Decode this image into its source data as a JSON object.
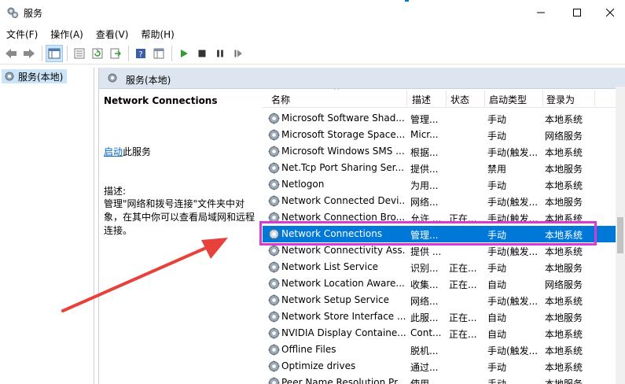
{
  "window": {
    "title": "服务"
  },
  "menu": [
    "文件(F)",
    "操作(A)",
    "查看(V)",
    "帮助(H)"
  ],
  "toolbar": {
    "icons": [
      "back-icon",
      "forward-icon",
      "console-tree-icon",
      "properties-icon",
      "refresh-icon",
      "export-icon",
      "help-icon",
      "view-icon",
      "start-service-icon",
      "stop-service-icon",
      "pause-service-icon",
      "resume-service-icon"
    ]
  },
  "tree": {
    "root_label": "服务(本地)"
  },
  "content": {
    "header_title": "服务(本地)",
    "selected_service_title": "Network Connections",
    "action_link": "启动",
    "action_suffix": "此服务",
    "desc_label": "描述:",
    "desc_text": "管理\"网络和拨号连接\"文件夹中对象，在其中你可以查看局域网和远程连接。"
  },
  "columns": {
    "name": "名称",
    "desc": "描述",
    "status": "状态",
    "start": "启动类型",
    "logon": "登录为"
  },
  "services": [
    {
      "name": "Microsoft Software Shad...",
      "desc": "管理...",
      "status": "",
      "start": "手动",
      "logon": "本地系统"
    },
    {
      "name": "Microsoft Storage Space...",
      "desc": "Micr...",
      "status": "",
      "start": "手动",
      "logon": "网络服务"
    },
    {
      "name": "Microsoft Windows SMS ...",
      "desc": "根据...",
      "status": "",
      "start": "手动(触发...",
      "logon": "本地系统"
    },
    {
      "name": "Net.Tcp Port Sharing Ser...",
      "desc": "提供...",
      "status": "",
      "start": "禁用",
      "logon": "本地服务"
    },
    {
      "name": "Netlogon",
      "desc": "为用...",
      "status": "",
      "start": "手动",
      "logon": "本地系统"
    },
    {
      "name": "Network Connected Devi...",
      "desc": "网络...",
      "status": "",
      "start": "手动(触发...",
      "logon": "本地服务"
    },
    {
      "name": "Network Connection Bro...",
      "desc": "允许 ...",
      "status": "正在...",
      "start": "手动(触发...",
      "logon": "本地系统"
    },
    {
      "name": "Network Connections",
      "desc": "管理...",
      "status": "",
      "start": "手动",
      "logon": "本地系统",
      "selected": true
    },
    {
      "name": "Network Connectivity Ass...",
      "desc": "提供 ...",
      "status": "",
      "start": "手动(触发...",
      "logon": "本地系统"
    },
    {
      "name": "Network List Service",
      "desc": "识别...",
      "status": "正在...",
      "start": "手动",
      "logon": "本地服务"
    },
    {
      "name": "Network Location Aware...",
      "desc": "收集...",
      "status": "正在...",
      "start": "自动",
      "logon": "网络服务"
    },
    {
      "name": "Network Setup Service",
      "desc": "网络...",
      "status": "",
      "start": "手动(触发...",
      "logon": "本地系统"
    },
    {
      "name": "Network Store Interface ...",
      "desc": "此服...",
      "status": "正在...",
      "start": "自动",
      "logon": "本地服务"
    },
    {
      "name": "NVIDIA Display Containe...",
      "desc": "Cont...",
      "status": "正在...",
      "start": "自动",
      "logon": "本地系统"
    },
    {
      "name": "Offline Files",
      "desc": "脱机...",
      "status": "",
      "start": "手动(触发...",
      "logon": "本地系统"
    },
    {
      "name": "Optimize drives",
      "desc": "通过...",
      "status": "",
      "start": "手动",
      "logon": "本地系统"
    },
    {
      "name": "Peer Name Resolution Pr...",
      "desc": "使用...",
      "status": "",
      "start": "手动",
      "logon": "本地服务"
    }
  ],
  "colors": {
    "selection": "#0078d7",
    "highlight_box": "#d63bd6",
    "annotation_arrow": "#e8403a",
    "header_bg": "#dde6f0"
  }
}
